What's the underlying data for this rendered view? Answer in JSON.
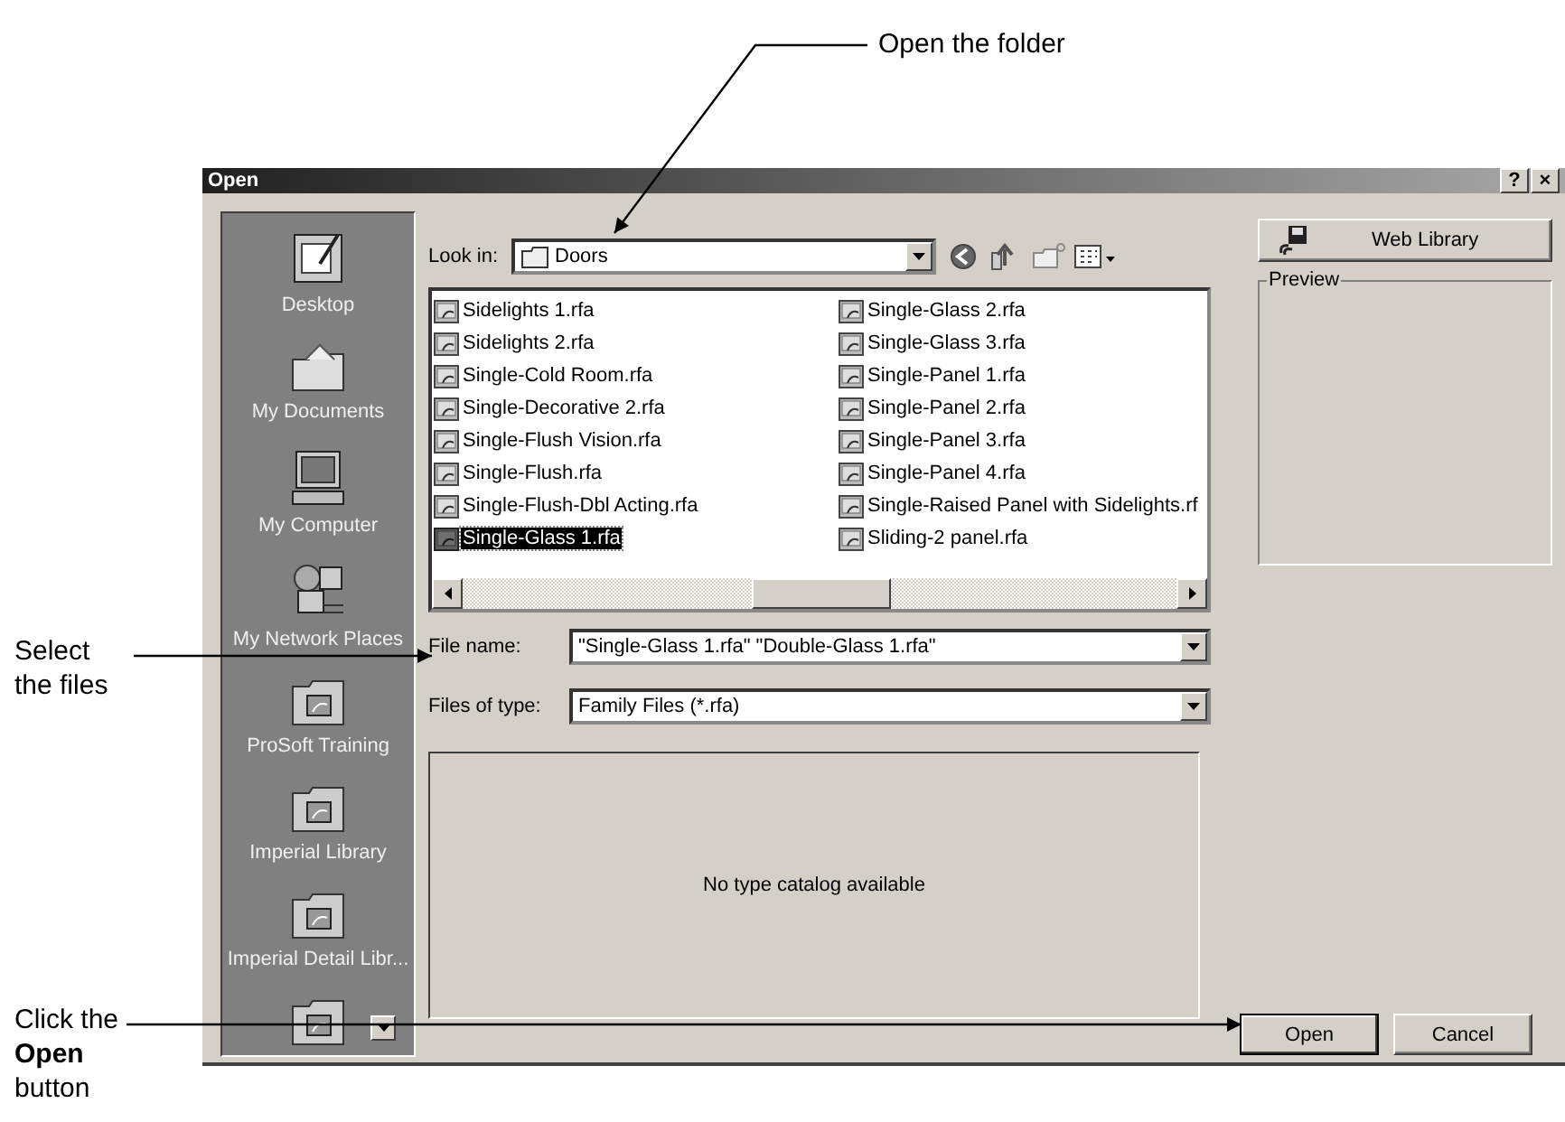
{
  "callouts": [
    {
      "text": "Open the folder"
    },
    {
      "text": "Select the files"
    },
    {
      "text": "Click the **Open** button"
    }
  ],
  "window": {
    "title": "Open",
    "title_buttons": [
      "?",
      "×"
    ]
  },
  "places": [
    {
      "kind": "desktop",
      "label": "Desktop"
    },
    {
      "kind": "documents",
      "label": "My Documents"
    },
    {
      "kind": "computer",
      "label": "My Computer"
    },
    {
      "kind": "network",
      "label": "My Network Places"
    },
    {
      "kind": "folder",
      "label": "ProSoft Training"
    },
    {
      "kind": "folder",
      "label": "Imperial Library"
    },
    {
      "kind": "folder",
      "label": "Imperial Detail Libr..."
    },
    {
      "kind": "folder"
    }
  ],
  "look_in": {
    "label": "Look in:",
    "value": "Doors"
  },
  "web_library": "Web Library",
  "preview": {
    "label": "Preview"
  },
  "files": [
    {
      "name": "Sidelights 1.rfa",
      "selected": false
    },
    {
      "name": "Sidelights 2.rfa",
      "selected": false
    },
    {
      "name": "Single-Cold Room.rfa",
      "selected": false
    },
    {
      "name": "Single-Decorative 2.rfa",
      "selected": false
    },
    {
      "name": "Single-Flush Vision.rfa",
      "selected": false
    },
    {
      "name": "Single-Flush.rfa",
      "selected": false
    },
    {
      "name": "Single-Flush-Dbl Acting.rfa",
      "selected": false
    },
    {
      "name": "Single-Glass 1.rfa",
      "selected": true
    },
    {
      "name": "Single-Glass 2.rfa",
      "selected": false
    },
    {
      "name": "Single-Glass 3.rfa",
      "selected": false
    },
    {
      "name": "Single-Panel 1.rfa",
      "selected": false
    },
    {
      "name": "Single-Panel 2.rfa",
      "selected": false
    },
    {
      "name": "Single-Panel 3.rfa",
      "selected": false
    },
    {
      "name": "Single-Panel 4.rfa",
      "selected": false
    },
    {
      "name": "Single-Raised Panel with Sidelights.rf",
      "selected": false
    },
    {
      "name": "Sliding-2 panel.rfa",
      "selected": false
    }
  ],
  "file_name": {
    "label": "File name:",
    "value": "\"Single-Glass 1.rfa\" \"Double-Glass 1.rfa\""
  },
  "file_type": {
    "label": "Files of type:",
    "value": "Family Files (*.rfa)"
  },
  "catalog": {
    "message": "No type catalog available"
  },
  "buttons": [
    "Open",
    "Cancel"
  ]
}
